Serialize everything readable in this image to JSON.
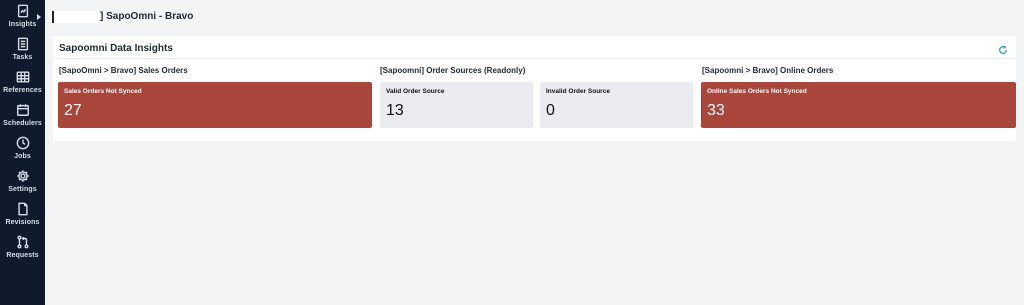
{
  "sidebar": {
    "items": [
      {
        "label": "Insights",
        "icon": "insights-icon"
      },
      {
        "label": "Tasks",
        "icon": "tasks-icon"
      },
      {
        "label": "References",
        "icon": "table-icon"
      },
      {
        "label": "Schedulers",
        "icon": "calendar-icon"
      },
      {
        "label": "Jobs",
        "icon": "clock-icon"
      },
      {
        "label": "Settings",
        "icon": "gear-icon"
      },
      {
        "label": "Revisions",
        "icon": "document-icon"
      },
      {
        "label": "Requests",
        "icon": "pull-request-icon"
      }
    ]
  },
  "header": {
    "title": "] SapoOmni - Bravo"
  },
  "panel": {
    "title": "Sapoomni Data Insights",
    "refresh_icon": "refresh-icon",
    "groups": [
      {
        "title": "[SapoOmni > Bravo] Sales Orders",
        "cards": [
          {
            "label": "Sales Orders Not Synced",
            "value": "27",
            "color": "#a8463c"
          }
        ]
      },
      {
        "title": "[Sapoomni] Order Sources (Readonly)",
        "cards": [
          {
            "label": "Valid Order Source",
            "value": "13",
            "color": "#ebecef"
          },
          {
            "label": "Invalid Order Source",
            "value": "0",
            "color": "#ebecef"
          }
        ]
      },
      {
        "title": "[Sapoomni > Bravo] Online Orders",
        "cards": [
          {
            "label": "Online Sales Orders Not Synced",
            "value": "33",
            "color": "#a8463c"
          }
        ]
      }
    ]
  }
}
